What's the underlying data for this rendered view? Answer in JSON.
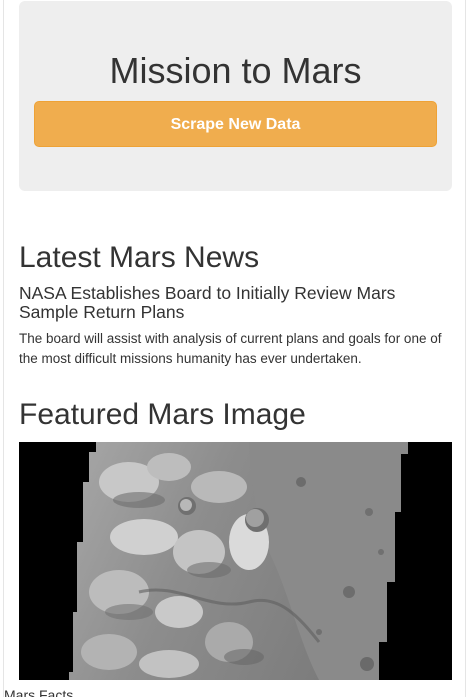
{
  "header": {
    "title": "Mission to Mars",
    "scrape_button_label": "Scrape New Data"
  },
  "news": {
    "heading": "Latest Mars News",
    "title": "NASA Establishes Board to Initially Review Mars Sample Return Plans",
    "paragraph": "The board will assist with analysis of current plans and goals for one of the most difficult missions humanity has ever undertaken."
  },
  "featured_image": {
    "heading": "Featured Mars Image",
    "alt": "grayscale orbital image of the Martian surface"
  },
  "facts": {
    "heading": "Mars Facts"
  },
  "colors": {
    "button_background": "#f0ad4e",
    "jumbotron_background": "#eeeeee",
    "text": "#333333"
  }
}
